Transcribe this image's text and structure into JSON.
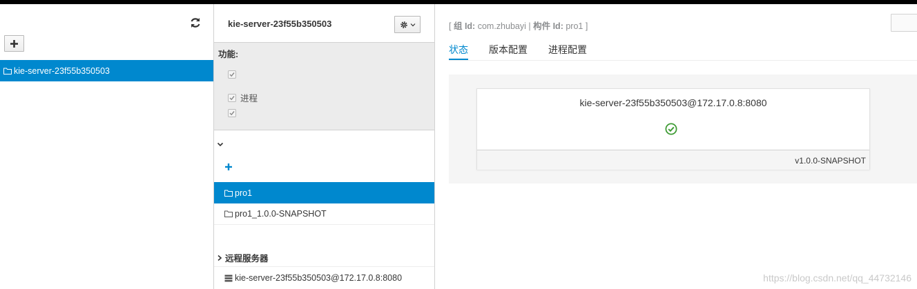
{
  "left_panel": {
    "server_item": "kie-server-23f55b350503"
  },
  "middle_panel": {
    "title": "kie-server-23f55b350503",
    "capabilities_label": "功能:",
    "capabilities": [
      "",
      "进程",
      ""
    ],
    "containers": [
      "pro1",
      "pro1_1.0.0-SNAPSHOT"
    ],
    "remote_servers_label": "远程服务器",
    "remote_server": "kie-server-23f55b350503@172.17.0.8:8080"
  },
  "right_panel": {
    "breadcrumb": {
      "open": "[",
      "group_label": "组 Id:",
      "group_value": "com.zhubayi",
      "sep": "|",
      "artifact_label": "构件 Id:",
      "artifact_value": "pro1",
      "close": "]"
    },
    "tabs": [
      "状态",
      "版本配置",
      "进程配置"
    ],
    "card": {
      "title": "kie-server-23f55b350503@172.17.0.8:8080",
      "version": "v1.0.0-SNAPSHOT"
    }
  },
  "watermark": "https://blog.csdn.net/qq_44732146",
  "colors": {
    "accent": "#0088ce",
    "ok": "#3f9c35"
  }
}
